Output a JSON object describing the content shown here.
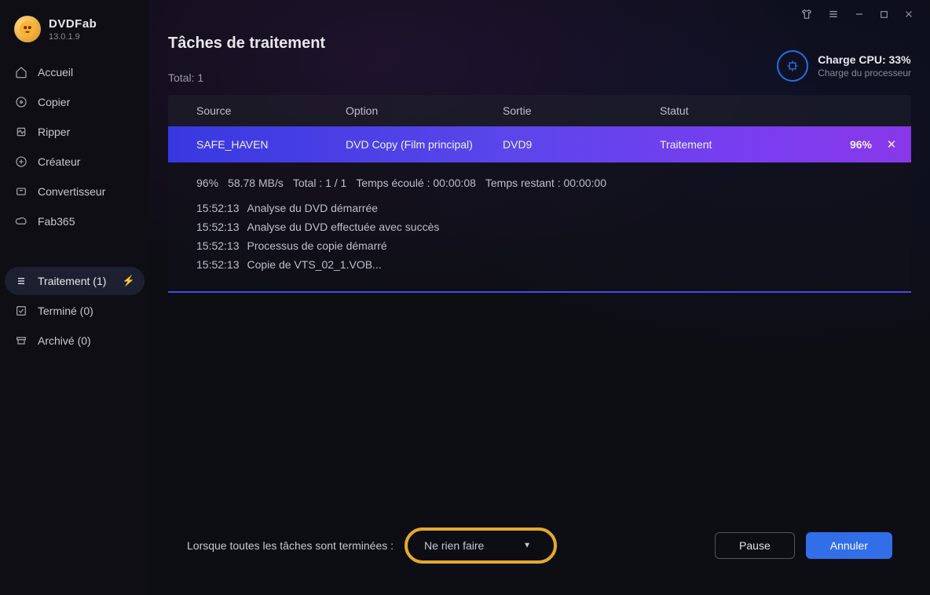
{
  "brand": {
    "name": "DVDFab",
    "version": "13.0.1.9"
  },
  "sidebar": {
    "items": [
      {
        "label": "Accueil"
      },
      {
        "label": "Copier"
      },
      {
        "label": "Ripper"
      },
      {
        "label": "Créateur"
      },
      {
        "label": "Convertisseur"
      },
      {
        "label": "Fab365"
      },
      {
        "label": "Traitement (1)"
      },
      {
        "label": "Terminé (0)"
      },
      {
        "label": "Archivé (0)"
      }
    ]
  },
  "page": {
    "title": "Tâches de traitement",
    "total_label": "Total: 1"
  },
  "cpu": {
    "title": "Charge CPU: 33%",
    "sub": "Charge du processeur"
  },
  "columns": {
    "source": "Source",
    "option": "Option",
    "sortie": "Sortie",
    "statut": "Statut"
  },
  "task": {
    "source": "SAFE_HAVEN",
    "option": "DVD Copy (Film principal)",
    "sortie": "DVD9",
    "statut": "Traitement",
    "pct": "96%"
  },
  "stats": {
    "pct": "96%",
    "speed": "58.78 MB/s",
    "total": "Total : 1 / 1",
    "elapsed": "Temps écoulé : 00:00:08",
    "remaining": "Temps restant : 00:00:00"
  },
  "log": [
    {
      "time": "15:52:13",
      "msg": "Analyse du DVD démarrée"
    },
    {
      "time": "15:52:13",
      "msg": "Analyse du DVD effectuée avec succès"
    },
    {
      "time": "15:52:13",
      "msg": "Processus de copie démarré"
    },
    {
      "time": "15:52:13",
      "msg": "Copie de VTS_02_1.VOB..."
    }
  ],
  "footer": {
    "label": "Lorsque toutes les tâches sont terminées :",
    "select": "Ne rien faire",
    "pause": "Pause",
    "cancel": "Annuler"
  }
}
